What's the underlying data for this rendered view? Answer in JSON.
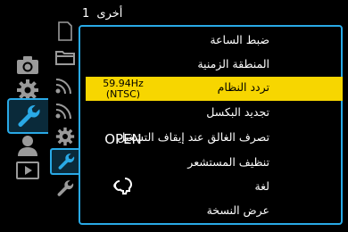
{
  "header": {
    "title": "أخرى",
    "page": "1"
  },
  "categories": [
    {
      "name": "camera-icon"
    },
    {
      "name": "gear-icon"
    },
    {
      "name": "wrench-icon",
      "selected": true
    },
    {
      "name": "person-icon"
    },
    {
      "name": "play-icon"
    }
  ],
  "subtabs": [
    {
      "name": "card-icon"
    },
    {
      "name": "folder-icon"
    },
    {
      "name": "wifi-icon"
    },
    {
      "name": "wifi-icon"
    },
    {
      "name": "gear-icon"
    },
    {
      "name": "wrench-small-icon",
      "selected": true
    },
    {
      "name": "wrench-small-icon"
    }
  ],
  "menu": {
    "items": [
      {
        "label": "ضبط الساعة",
        "value": ""
      },
      {
        "label": "المنطقة الزمنية",
        "value": ""
      },
      {
        "label": "تردد النظام",
        "value_line1": "59.94Hz",
        "value_line2": "(NTSC)",
        "highlighted": true
      },
      {
        "label": "تجديد البكسل",
        "value": ""
      },
      {
        "label": "تصرف الغالق عند إيقاف التشغيل",
        "value": "OPEN"
      },
      {
        "label": "تنظيف المستشعر",
        "value": ""
      },
      {
        "label": "لغة",
        "value_icon": "speech-head-icon"
      },
      {
        "label": "عرض النسخة",
        "value": ""
      }
    ]
  },
  "colors": {
    "accent": "#29a9e6",
    "highlight": "#f7d600"
  }
}
